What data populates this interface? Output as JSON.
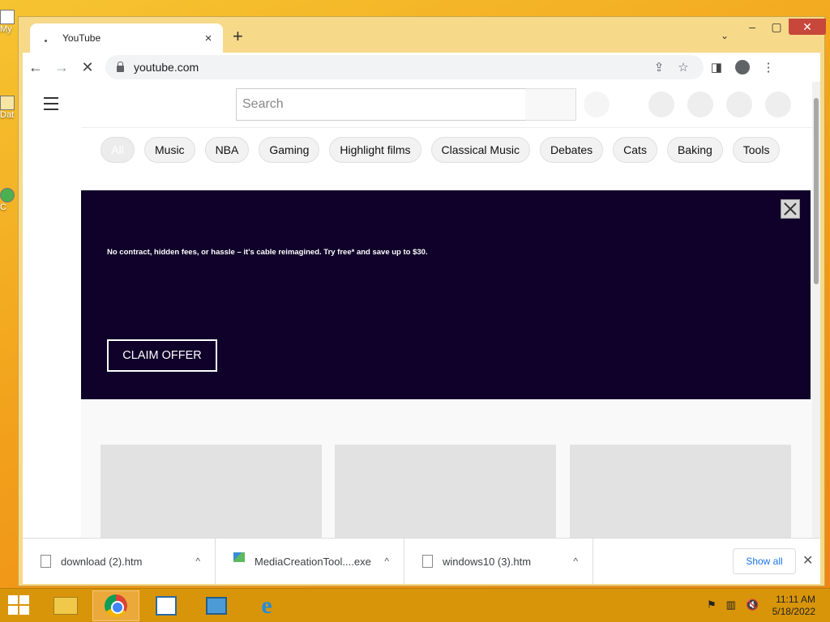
{
  "desktop": {
    "icons": [
      {
        "label": "My"
      },
      {
        "label": "Dat"
      },
      {
        "label": "C"
      }
    ]
  },
  "browser": {
    "tab": {
      "title": "YouTube",
      "close": "×"
    },
    "new_tab": "+",
    "tab_search": "⌄",
    "window_controls": {
      "minimize": "–",
      "maximize": "▢",
      "close": "✕"
    },
    "toolbar": {
      "back": "←",
      "forward": "→",
      "reload": "✕",
      "url": "youtube.com",
      "share": "⇪",
      "bookmark": "☆",
      "sidebar": "◨",
      "menu": "⋮"
    }
  },
  "youtube": {
    "search_placeholder": "Search",
    "chips": [
      "All",
      "Music",
      "NBA",
      "Gaming",
      "Highlight films",
      "Classical Music",
      "Debates",
      "Cats",
      "Baking",
      "Tools"
    ],
    "ad": {
      "text": "No contract, hidden fees, or hassle – it's cable reimagined. Try free* and save up to $30.",
      "cta": "CLAIM OFFER",
      "background": "#0f0129"
    }
  },
  "downloads": {
    "items": [
      {
        "name": "download (2).htm",
        "caret": "^"
      },
      {
        "name": "MediaCreationTool....exe",
        "caret": "^"
      },
      {
        "name": "windows10 (3).htm",
        "caret": "^"
      }
    ],
    "show_all": "Show all",
    "close": "✕"
  },
  "taskbar": {
    "apps": [
      "folder-icon",
      "chrome-icon",
      "app-icon",
      "media-creation-icon",
      "internet-explorer-icon"
    ],
    "ie_glyph": "e",
    "tray": {
      "flag": "⚑",
      "network": "▥",
      "volume": "🔇"
    },
    "time": "11:11 AM",
    "date": "5/18/2022"
  },
  "colors": {
    "desktop": "#f2a21c",
    "taskbar": "#d9950a",
    "ad_background": "#0f0129",
    "link_blue": "#1a73e8"
  }
}
